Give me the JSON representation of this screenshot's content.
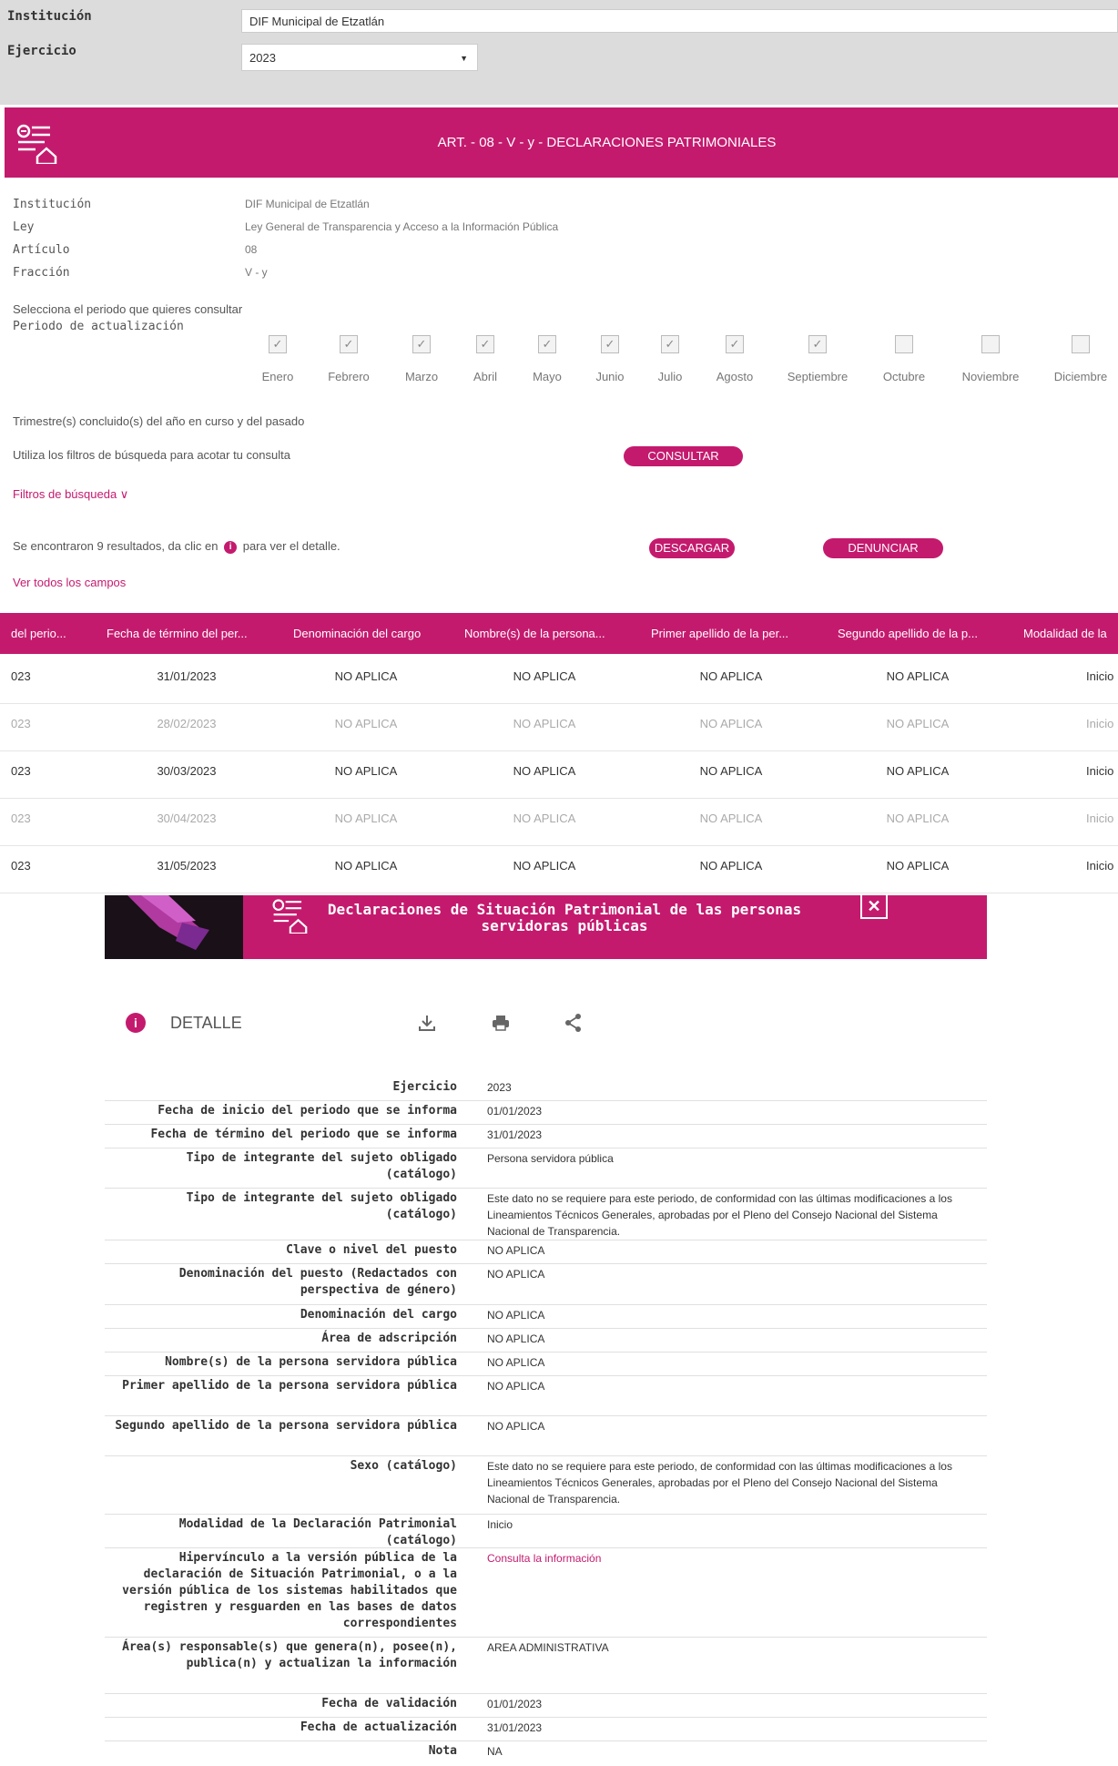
{
  "top": {
    "institucion_label": "Institución",
    "institucion_value": "DIF Municipal de Etzatlán",
    "ejercicio_label": "Ejercicio",
    "ejercicio_value": "2023"
  },
  "banner": {
    "title": "ART. - 08 - V - y - DECLARACIONES PATRIMONIALES"
  },
  "info": {
    "labels": [
      "Institución",
      "Ley",
      "Artículo",
      "Fracción"
    ],
    "values": [
      "DIF Municipal de Etzatlán",
      "Ley General de Transparencia y Acceso a la Información Pública",
      "08",
      "V - y"
    ]
  },
  "periodo": {
    "prompt": "Selecciona el periodo que quieres consultar",
    "label": "Periodo de actualización",
    "months": [
      {
        "name": "Enero",
        "checked": true
      },
      {
        "name": "Febrero",
        "checked": true
      },
      {
        "name": "Marzo",
        "checked": true
      },
      {
        "name": "Abril",
        "checked": true
      },
      {
        "name": "Mayo",
        "checked": true
      },
      {
        "name": "Junio",
        "checked": true
      },
      {
        "name": "Julio",
        "checked": true
      },
      {
        "name": "Agosto",
        "checked": true
      },
      {
        "name": "Septiembre",
        "checked": true
      },
      {
        "name": "Octubre",
        "checked": false
      },
      {
        "name": "Noviembre",
        "checked": false
      },
      {
        "name": "Diciembre",
        "checked": false
      }
    ]
  },
  "filters": {
    "trimestre_text": "Trimestre(s) concluido(s) del año en curso y del pasado",
    "filtros_text": "Utiliza los filtros de búsqueda para acotar tu consulta",
    "consultar": "CONSULTAR",
    "filtros_link": "Filtros de búsqueda ∨"
  },
  "results": {
    "text_before": "Se encontraron 9 resultados, da clic en",
    "text_after": "para ver el detalle.",
    "descargar": "DESCARGAR",
    "denunciar": "DENUNCIAR",
    "ver_todos": "Ver todos los campos"
  },
  "table": {
    "headers": [
      "del perio...",
      "Fecha de término del per...",
      "Denominación del cargo",
      "Nombre(s) de la persona...",
      "Primer apellido de la per...",
      "Segundo apellido de la p...",
      "Modalidad de la"
    ],
    "rows": [
      [
        "023",
        "31/01/2023",
        "NO APLICA",
        "NO APLICA",
        "NO APLICA",
        "NO APLICA",
        "Inicio"
      ],
      [
        "023",
        "28/02/2023",
        "NO APLICA",
        "NO APLICA",
        "NO APLICA",
        "NO APLICA",
        "Inicio"
      ],
      [
        "023",
        "30/03/2023",
        "NO APLICA",
        "NO APLICA",
        "NO APLICA",
        "NO APLICA",
        "Inicio"
      ],
      [
        "023",
        "30/04/2023",
        "NO APLICA",
        "NO APLICA",
        "NO APLICA",
        "NO APLICA",
        "Inicio"
      ],
      [
        "023",
        "31/05/2023",
        "NO APLICA",
        "NO APLICA",
        "NO APLICA",
        "NO APLICA",
        "Inicio"
      ]
    ]
  },
  "modal": {
    "title": "Declaraciones de Situación Patrimonial de las personas servidoras públicas",
    "close": "✕",
    "detalle": "DETALLE",
    "fields": [
      {
        "label": "Ejercicio",
        "value": "2023"
      },
      {
        "label": "Fecha de inicio del periodo que se informa",
        "value": "01/01/2023"
      },
      {
        "label": "Fecha de término del periodo que se informa",
        "value": "31/01/2023"
      },
      {
        "label": "Tipo de integrante del sujeto obligado (catálogo)",
        "value": "Persona servidora pública"
      },
      {
        "label": "Tipo de integrante del sujeto obligado (catálogo)",
        "value": "Este dato no se requiere para este periodo, de conformidad con las últimas modificaciones a los Lineamientos Técnicos Generales, aprobadas por el Pleno del Consejo Nacional del Sistema Nacional de Transparencia."
      },
      {
        "label": "Clave o nivel del puesto",
        "value": "NO APLICA"
      },
      {
        "label": "Denominación del puesto (Redactados con perspectiva de género)",
        "value": "NO APLICA"
      },
      {
        "label": "Denominación del cargo",
        "value": "NO APLICA"
      },
      {
        "label": "Área de adscripción",
        "value": "NO APLICA"
      },
      {
        "label": "Nombre(s) de la persona servidora pública",
        "value": "NO APLICA"
      },
      {
        "label": "Primer apellido de la persona servidora pública",
        "value": "NO APLICA"
      },
      {
        "label": "Segundo apellido de la persona servidora pública",
        "value": "NO APLICA"
      },
      {
        "label": "Sexo (catálogo)",
        "value": "Este dato no se requiere para este periodo, de conformidad con las últimas modificaciones a los Lineamientos Técnicos Generales, aprobadas por el Pleno del Consejo Nacional del Sistema Nacional de Transparencia."
      },
      {
        "label": "Modalidad de la Declaración Patrimonial (catálogo)",
        "value": "Inicio"
      },
      {
        "label": "Hipervínculo a la versión pública de la declaración de Situación Patrimonial, o a la versión pública de los sistemas habilitados que registren y resguarden en las bases de datos correspondientes",
        "value": "Consulta la información"
      },
      {
        "label": "Área(s) responsable(s) que genera(n), posee(n), publica(n) y actualizan la información",
        "value": "AREA ADMINISTRATIVA"
      },
      {
        "label": "Fecha de validación",
        "value": "01/01/2023"
      },
      {
        "label": "Fecha de actualización",
        "value": "31/01/2023"
      },
      {
        "label": "Nota",
        "value": "NA"
      }
    ]
  }
}
